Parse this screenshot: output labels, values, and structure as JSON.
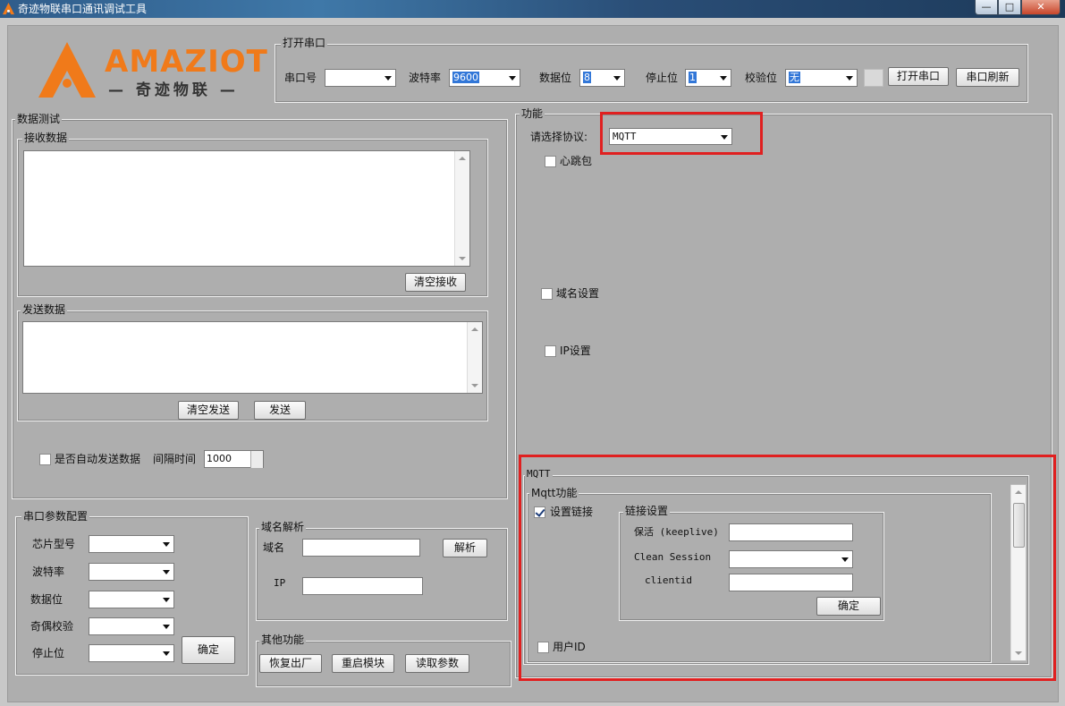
{
  "window": {
    "title": "奇迹物联串口通讯调试工具",
    "minimize": "—",
    "maximize": "□",
    "close": "✕"
  },
  "logo": {
    "brand": "AMAZIOT",
    "tagline": "— 奇迹物联 —",
    "color": "#f07a1a"
  },
  "serial_open": {
    "group_title": "打开串口",
    "port_label": "串口号",
    "port_value": "",
    "baud_label": "波特率",
    "baud_value": "9600",
    "databits_label": "数据位",
    "databits_value": "8",
    "stopbits_label": "停止位",
    "stopbits_value": "1",
    "parity_label": "校验位",
    "parity_value": "无",
    "open_button": "打开串口",
    "refresh_button": "串口刷新"
  },
  "data_test": {
    "group_title": "数据测试",
    "receive_title": "接收数据",
    "clear_receive": "清空接收",
    "send_title": "发送数据",
    "clear_send": "清空发送",
    "send_button": "发送",
    "auto_send_label": "是否自动发送数据",
    "interval_label": "间隔时间",
    "interval_value": "1000"
  },
  "serial_config": {
    "group_title": "串口参数配置",
    "chip_label": "芯片型号",
    "baud_label": "波特率",
    "databits_label": "数据位",
    "parity_label": "奇偶校验",
    "stopbits_label": "停止位",
    "confirm_button": "确定"
  },
  "dns": {
    "group_title": "域名解析",
    "domain_label": "域名",
    "resolve_button": "解析",
    "ip_label": "IP"
  },
  "other": {
    "group_title": "其他功能",
    "factory_reset": "恢复出厂",
    "restart": "重启模块",
    "read_params": "读取参数"
  },
  "function": {
    "group_title": "功能",
    "protocol_label": "请选择协议:",
    "protocol_value": "MQTT",
    "heartbeat_label": "心跳包",
    "domain_setting_label": "域名设置",
    "ip_setting_label": "IP设置"
  },
  "mqtt": {
    "group_title": "MQTT",
    "func_title": "Mqtt功能",
    "set_link_label": "设置链接",
    "link_title": "链接设置",
    "keepalive_label": "保活 (keeplive)",
    "clean_session_label": "Clean Session",
    "clientid_label": "clientid",
    "confirm_button": "确定",
    "user_id_label": "用户ID"
  }
}
